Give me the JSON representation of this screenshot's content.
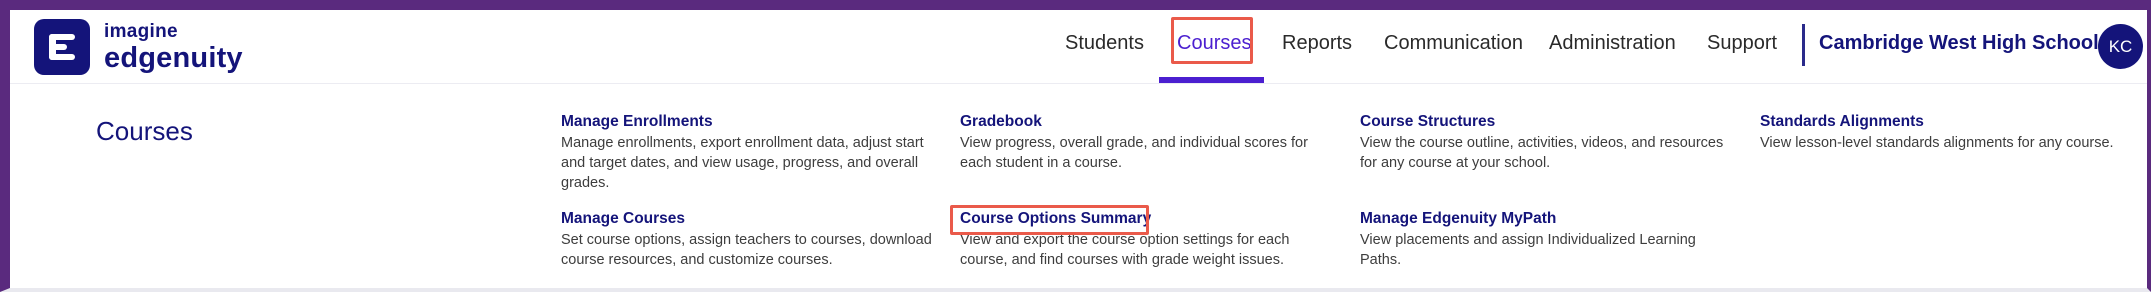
{
  "logo": {
    "line1": "imagine",
    "line2": "edgenuity"
  },
  "nav": {
    "items": [
      "Students",
      "Courses",
      "Reports",
      "Communication",
      "Administration",
      "Support"
    ],
    "active": "Courses",
    "school": "Cambridge West High School",
    "avatar_initials": "KC"
  },
  "menu": {
    "title": "Courses",
    "items": [
      {
        "label": "Manage Enrollments",
        "description": "Manage enrollments, export enrollment data, adjust start and target dates, and view usage, progress, and overall grades."
      },
      {
        "label": "Gradebook",
        "description": "View progress, overall grade, and individual scores for each student in a course."
      },
      {
        "label": "Course Structures",
        "description": "View the course outline, activities, videos, and resources for any course at your school."
      },
      {
        "label": "Standards Alignments",
        "description": "View lesson-level standards alignments for any course."
      },
      {
        "label": "Manage Courses",
        "description": "Set course options, assign teachers to courses, download course resources, and customize courses."
      },
      {
        "label": "Course Options Summary",
        "description": "View and export the course option settings for each course, and find courses with grade weight issues."
      },
      {
        "label": "Manage Edgenuity MyPath",
        "description": "View placements and assign Individualized Learning Paths."
      }
    ]
  },
  "colors": {
    "brand": "#14147a",
    "accent": "#4b1fd0",
    "highlight": "#ea5a4a",
    "frame": "#5a2a7e"
  }
}
